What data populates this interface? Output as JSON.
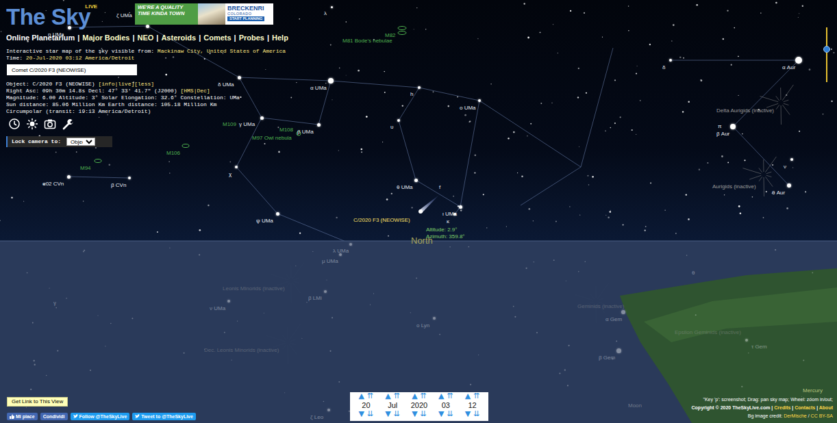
{
  "logo": {
    "title": "The Sky",
    "badge": "LIVE"
  },
  "ad": {
    "headline": "WE'RE A QUALITY TIME KINDA TOWN",
    "brand": "BRECKENRI",
    "region": "COLORADO",
    "cta": "START PLANNING"
  },
  "nav": {
    "separator": "|",
    "items": [
      {
        "label": "Online Planetarium",
        "selected": true
      },
      {
        "label": "Major Bodies",
        "selected": false
      },
      {
        "label": "NEO",
        "selected": false
      },
      {
        "label": "Asteroids",
        "selected": false
      },
      {
        "label": "Comets",
        "selected": false
      },
      {
        "label": "Probes",
        "selected": false
      },
      {
        "label": "Help",
        "selected": false
      }
    ]
  },
  "info_lines": [
    [
      {
        "text": "Interactive star map of the sky visible from: ",
        "link": false
      },
      {
        "text": "Mackinaw City, United States of America",
        "link": true
      }
    ],
    [
      {
        "text": "Time: ",
        "link": false
      },
      {
        "text": "20-Jul-2020 03:12 America/Detroit",
        "link": true
      }
    ]
  ],
  "search": {
    "value": "Comet C/2020 F3 (NEOWISE)"
  },
  "object_lines": [
    [
      {
        "text": "Object: C/2020 F3 (NEOWISE) ",
        "link": false
      },
      {
        "text": "[info|live][less]",
        "link": true
      }
    ],
    [
      {
        "text": "Right Asc: 09h 30m 14.8s Decl: 47° 33' 41.7\" (J2000) ",
        "link": false
      },
      {
        "text": "[HMS|Dec]",
        "link": true
      }
    ],
    [
      {
        "text": "Magnitude: 6.00 Altitude: 3° Solar Elongation: 32.6° Constellation: UMa",
        "link": false
      }
    ],
    [
      {
        "text": "Sun distance: 85.06 Million Km Earth distance: 105.18 Million Km",
        "link": false
      }
    ],
    [
      {
        "text": "Circumpolar (transit: 19:13 America/Detroit)",
        "link": false
      }
    ]
  ],
  "lock": {
    "label": "Lock camera to:",
    "value": "Object"
  },
  "sky_labels": [
    {
      "text": "η UMa",
      "kind": "star",
      "below_horizon": false
    },
    {
      "text": "ζ UMa",
      "kind": "star",
      "below_horizon": false
    },
    {
      "text": "λ",
      "kind": "star",
      "below_horizon": false
    },
    {
      "text": "M82",
      "kind": "dso",
      "below_horizon": false
    },
    {
      "text": "M81 Bode's nebulae",
      "kind": "dso",
      "below_horizon": false
    },
    {
      "text": "δ UMa",
      "kind": "star",
      "below_horizon": false
    },
    {
      "text": "α UMa",
      "kind": "star",
      "below_horizon": false
    },
    {
      "text": "h",
      "kind": "star",
      "below_horizon": false
    },
    {
      "text": "ο UMa",
      "kind": "star",
      "below_horizon": false
    },
    {
      "text": "δ",
      "kind": "star",
      "below_horizon": false
    },
    {
      "text": "α Aur",
      "kind": "star",
      "below_horizon": false
    },
    {
      "text": "Delta Aurigids (inactive)",
      "kind": "shower",
      "below_horizon": false
    },
    {
      "text": "π",
      "kind": "star",
      "below_horizon": false
    },
    {
      "text": "β Aur",
      "kind": "star",
      "below_horizon": false
    },
    {
      "text": "M109",
      "kind": "dso",
      "below_horizon": false
    },
    {
      "text": "γ UMa",
      "kind": "star",
      "below_horizon": false
    },
    {
      "text": "M97 Owl nebula",
      "kind": "dso",
      "below_horizon": false
    },
    {
      "text": "M108",
      "kind": "dso",
      "below_horizon": false
    },
    {
      "text": "β UMa",
      "kind": "star",
      "below_horizon": false
    },
    {
      "text": "υ",
      "kind": "star",
      "below_horizon": false
    },
    {
      "text": "M106",
      "kind": "dso",
      "below_horizon": false
    },
    {
      "text": "M94",
      "kind": "dso",
      "below_horizon": false
    },
    {
      "text": "χ",
      "kind": "star",
      "below_horizon": false
    },
    {
      "text": "α02 CVn",
      "kind": "star",
      "below_horizon": false
    },
    {
      "text": "β CVn",
      "kind": "star",
      "below_horizon": false
    },
    {
      "text": "θ UMa",
      "kind": "star",
      "below_horizon": false
    },
    {
      "text": "f",
      "kind": "star",
      "below_horizon": false
    },
    {
      "text": "ν",
      "kind": "star",
      "below_horizon": false
    },
    {
      "text": "Aurigids (inactive)",
      "kind": "shower",
      "below_horizon": false
    },
    {
      "text": "θ Aur",
      "kind": "star",
      "below_horizon": false
    },
    {
      "text": "C/2020 F3 (NEOWISE)",
      "kind": "comet",
      "below_horizon": false
    },
    {
      "text": "ι UMa",
      "kind": "star",
      "below_horizon": false
    },
    {
      "text": "κ",
      "kind": "star",
      "below_horizon": false
    },
    {
      "text": "Altitude: 2.9°",
      "kind": "info",
      "below_horizon": false
    },
    {
      "text": "Azimuth: 359.8°",
      "kind": "info",
      "below_horizon": false
    },
    {
      "text": "ψ UMa",
      "kind": "star",
      "below_horizon": false
    },
    {
      "text": "North",
      "kind": "cardinal",
      "below_horizon": false
    },
    {
      "text": "Mercury",
      "kind": "planet",
      "below_horizon": false
    },
    {
      "text": "λ UMa",
      "kind": "star",
      "below_horizon": true
    },
    {
      "text": "μ UMa",
      "kind": "star",
      "below_horizon": true
    },
    {
      "text": "Leonis Minorids (inactive)",
      "kind": "shower",
      "below_horizon": true
    },
    {
      "text": "β LMi",
      "kind": "star",
      "below_horizon": true
    },
    {
      "text": "γ",
      "kind": "star",
      "below_horizon": true
    },
    {
      "text": "ν UMa",
      "kind": "star",
      "below_horizon": true
    },
    {
      "text": "Geminids (inactive)",
      "kind": "shower",
      "below_horizon": true
    },
    {
      "text": "α Gem",
      "kind": "star",
      "below_horizon": true
    },
    {
      "text": "ο Lyn",
      "kind": "star",
      "below_horizon": true
    },
    {
      "text": "Dec. Leonis Minorids (inactive)",
      "kind": "shower",
      "below_horizon": true
    },
    {
      "text": "Epsilon Geminids (inactive)",
      "kind": "shower",
      "below_horizon": true
    },
    {
      "text": "β Gem",
      "kind": "star",
      "below_horizon": true
    },
    {
      "text": "τ Gem",
      "kind": "star",
      "below_horizon": true
    },
    {
      "text": "θ",
      "kind": "star",
      "below_horizon": true
    },
    {
      "text": "ζ Leo",
      "kind": "star",
      "below_horizon": true
    },
    {
      "text": "Moon",
      "kind": "moon",
      "below_horizon": true
    }
  ],
  "zoom": {
    "level": 0.4
  },
  "link_button": "Get Link to This View",
  "date": {
    "arrows": {
      "up": "▲",
      "fast_up": "⇈",
      "down": "▼",
      "fast_down": "⇊"
    },
    "fields": [
      "20",
      "Jul",
      "2020",
      "03",
      "12"
    ]
  },
  "social": [
    {
      "label": "Mi piace",
      "color": "#4267b2"
    },
    {
      "label": "Condividi",
      "color": "#4267b2"
    },
    {
      "label": "Follow @TheSkyLive",
      "color": "#1d9bf0"
    },
    {
      "label": "Tweet to @TheSkyLive",
      "color": "#1d9bf0"
    }
  ],
  "footer": [
    [
      {
        "text": "\"Key 'p': screenshot; Drag: pan sky map; Wheel: zoom in/out;",
        "link": false
      }
    ],
    [
      {
        "text": "Copyright © 2020 TheSkyLive.com | ",
        "link": false
      },
      {
        "text": "Credits",
        "link": true
      },
      {
        "text": " | ",
        "link": false
      },
      {
        "text": "Contacts",
        "link": true
      },
      {
        "text": " | ",
        "link": false
      },
      {
        "text": "About",
        "link": true
      }
    ],
    [
      {
        "text": "Bg image credit: ",
        "link": false
      },
      {
        "text": "DerMische",
        "link": true
      },
      {
        "text": " / ",
        "link": false
      },
      {
        "text": "CC BY-SA",
        "link": true
      }
    ]
  ]
}
